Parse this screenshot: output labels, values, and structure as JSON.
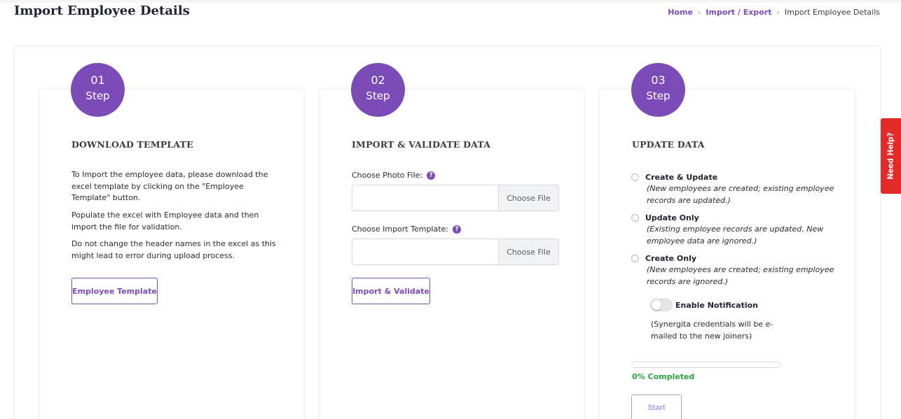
{
  "header": {
    "title": "Import Employee Details",
    "breadcrumb": {
      "home": "Home",
      "import_export": "Import / Export",
      "current": "Import Employee Details"
    }
  },
  "steps": [
    {
      "number": "01",
      "word": "Step",
      "title": "DOWNLOAD TEMPLATE",
      "paragraphs": [
        "To Import the employee data, please download the excel template by clicking on the \"Employee Template\" button.",
        "Populate the excel with Employee data and then import the file for validation.",
        "Do not change the header names in the excel as this might lead to error during upload process."
      ],
      "button_label": "Employee Template"
    },
    {
      "number": "02",
      "word": "Step",
      "title": "IMPORT & VALIDATE DATA",
      "photo_label": "Choose Photo File:",
      "template_label": "Choose Import Template:",
      "choose_file_label": "Choose File",
      "button_label": "Import & Validate"
    },
    {
      "number": "03",
      "word": "Step",
      "title": "UPDATE DATA",
      "options": [
        {
          "title": "Create & Update",
          "description": "(New employees are created; existing employee records are updated.)"
        },
        {
          "title": "Update Only",
          "description": "(Existing employee records are updated. New employee data are ignored.)"
        },
        {
          "title": "Create Only",
          "description": "(New employees are created; existing employee records are ignored.)"
        }
      ],
      "notification_label": "Enable Notification",
      "notification_enabled": false,
      "notification_note": "(Synergita credentials will be e-mailed to the new joiners)",
      "progress_percent": 0,
      "progress_text": "0% Completed",
      "start_label": "Start"
    }
  ],
  "help_icon_glyph": "?",
  "need_help_label": "Need Help?",
  "colors": {
    "accent": "#7b4cb8",
    "success": "#2aa63e",
    "help_tab": "#e32b2b"
  }
}
